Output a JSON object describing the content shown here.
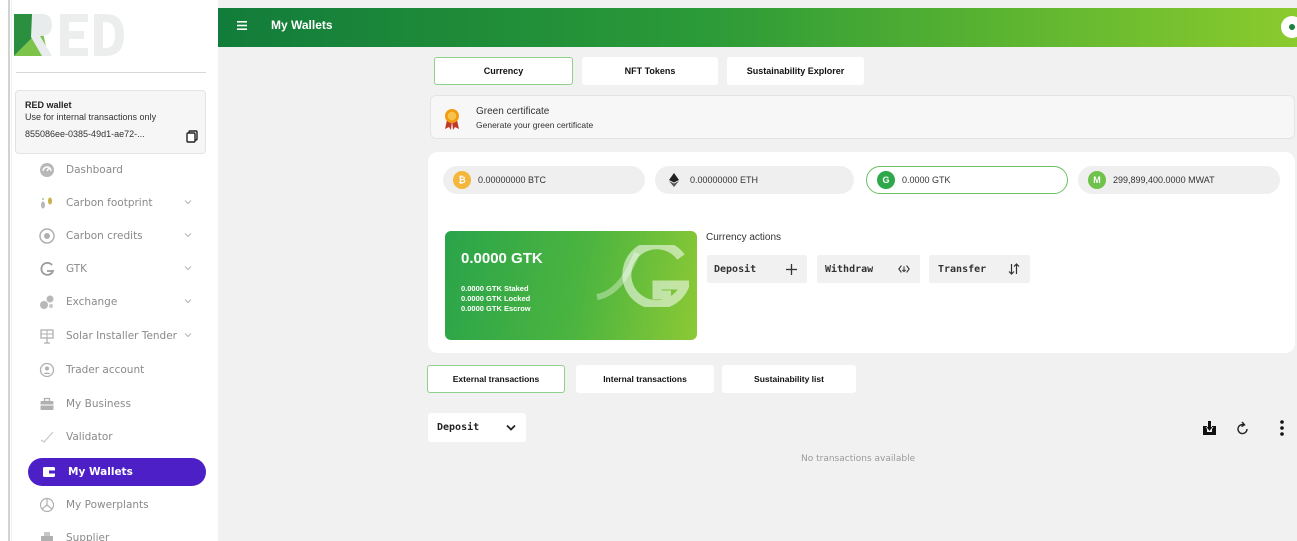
{
  "app": {
    "logo_text": "RED",
    "header_title": "My Wallets",
    "colors": {
      "accent_purple": "#4d1fc7",
      "brand_green": "#2b9a38",
      "light_green": "#8bcb2e"
    }
  },
  "wallet": {
    "title": "RED wallet",
    "subtitle": "Use for internal transactions only",
    "id": "855086ee-0385-49d1-ae72-..."
  },
  "sidebar": {
    "items": [
      {
        "label": "Dashboard",
        "icon": "dashboard-icon"
      },
      {
        "label": "Carbon footprint",
        "icon": "footprint-icon"
      },
      {
        "label": "Carbon credits",
        "icon": "credits-icon"
      },
      {
        "label": "GTK",
        "icon": "gtk-icon"
      },
      {
        "label": "Exchange",
        "icon": "exchange-icon"
      },
      {
        "label": "Solar Installer Tender",
        "icon": "solar-icon"
      },
      {
        "label": "Trader account",
        "icon": "trader-icon"
      },
      {
        "label": "My Business",
        "icon": "business-icon"
      },
      {
        "label": "Validator",
        "icon": "validator-icon"
      },
      {
        "label": "My Wallets",
        "icon": "wallet-icon"
      },
      {
        "label": "My Powerplants",
        "icon": "powerplant-icon"
      },
      {
        "label": "Supplier",
        "icon": "supplier-icon"
      }
    ]
  },
  "top_tabs": [
    {
      "label": "Currency"
    },
    {
      "label": "NFT Tokens"
    },
    {
      "label": "Sustainability Explorer"
    }
  ],
  "certificate": {
    "title": "Green certificate",
    "subtitle": "Generate your green certificate"
  },
  "currencies": [
    {
      "label": "0.00000000 BTC",
      "icon": "bitcoin-icon"
    },
    {
      "label": "0.00000000 ETH",
      "icon": "ethereum-icon"
    },
    {
      "label": "0.0000 GTK",
      "icon": "gtk-coin-icon"
    },
    {
      "label": "299,899,400.0000 MWAT",
      "icon": "mwat-coin-icon"
    }
  ],
  "gtk_card": {
    "amount": "0.0000 GTK",
    "staked": "0.0000 GTK Staked",
    "locked": "0.0000 GTK Locked",
    "escrow": "0.0000 GTK Escrow"
  },
  "actions": {
    "title": "Currency actions",
    "deposit": "Deposit",
    "withdraw": "Withdraw",
    "transfer": "Transfer"
  },
  "tx_tabs": [
    {
      "label": "External transactions"
    },
    {
      "label": "Internal transactions"
    },
    {
      "label": "Sustainability list"
    }
  ],
  "tx": {
    "filter_value": "Deposit",
    "empty_text": "No transactions available"
  }
}
